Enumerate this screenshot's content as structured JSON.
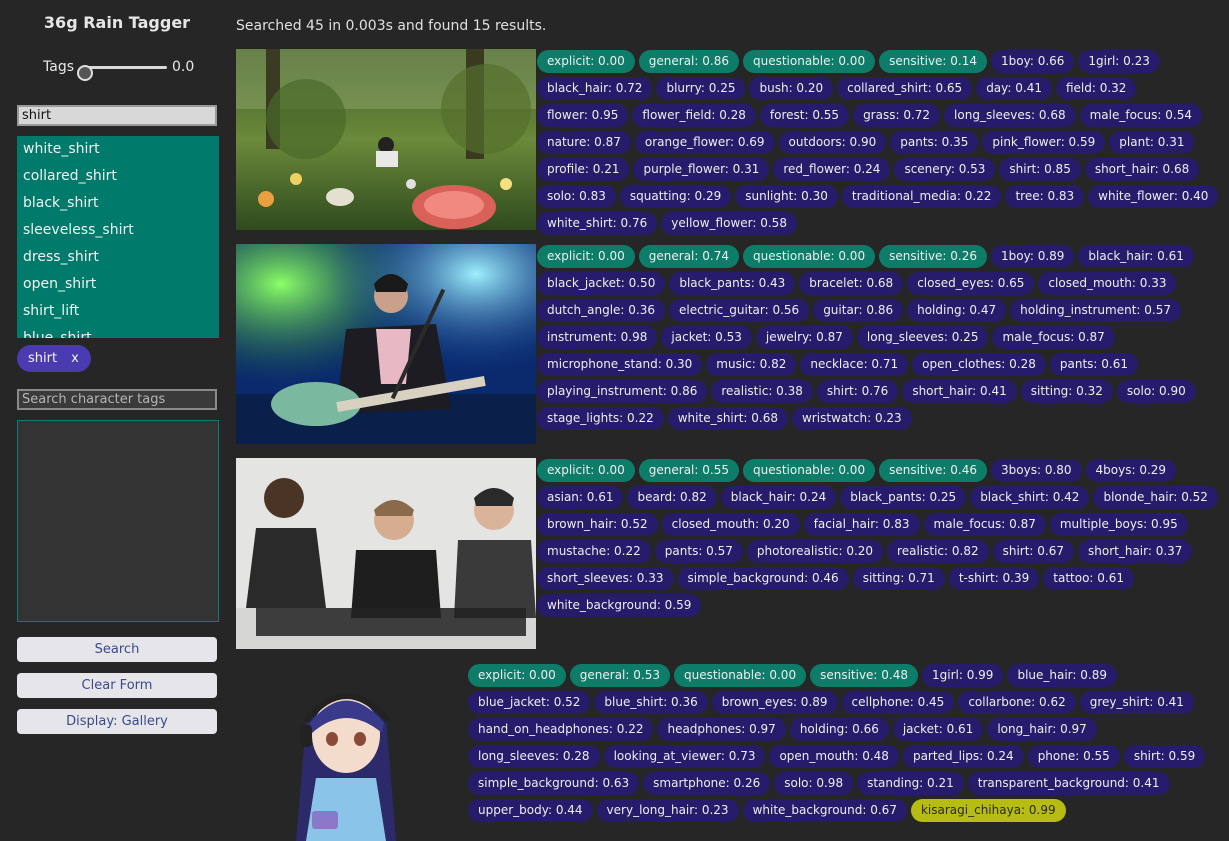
{
  "app": {
    "title": "36g Rain Tagger"
  },
  "controls": {
    "tags_label": "Tags",
    "tags_value": "0.0"
  },
  "tag_search": {
    "value": "shirt"
  },
  "suggestions": [
    "white_shirt",
    "collared_shirt",
    "black_shirt",
    "sleeveless_shirt",
    "dress_shirt",
    "open_shirt",
    "shirt_lift",
    "blue_shirt"
  ],
  "selected_chip": {
    "label": "shirt",
    "remove": "x"
  },
  "character_search": {
    "placeholder": "Search character tags"
  },
  "buttons": {
    "search": "Search",
    "clear": "Clear Form",
    "display": "Display: Gallery"
  },
  "status": "Searched 45 in 0.003s and found 15 results.",
  "colors": {
    "rating_tag": "#0d7d6a",
    "general_tag": "#261c6b",
    "character_tag": "#b6bc12",
    "suggestion_bg": "#007a6b",
    "chip_bg": "#4b3bb0"
  },
  "results": [
    {
      "rating": [
        "explicit: 0.00",
        "general: 0.86",
        "questionable: 0.00",
        "sensitive: 0.14"
      ],
      "general": [
        "1boy: 0.66",
        "1girl: 0.23",
        "black_hair: 0.72",
        "blurry: 0.25",
        "bush: 0.20",
        "collared_shirt: 0.65",
        "day: 0.41",
        "field: 0.32",
        "flower: 0.95",
        "flower_field: 0.28",
        "forest: 0.55",
        "grass: 0.72",
        "long_sleeves: 0.68",
        "male_focus: 0.54",
        "nature: 0.87",
        "orange_flower: 0.69",
        "outdoors: 0.90",
        "pants: 0.35",
        "pink_flower: 0.59",
        "plant: 0.31",
        "profile: 0.21",
        "purple_flower: 0.31",
        "red_flower: 0.24",
        "scenery: 0.53",
        "shirt: 0.85",
        "short_hair: 0.68",
        "solo: 0.83",
        "squatting: 0.29",
        "sunlight: 0.30",
        "traditional_media: 0.22",
        "tree: 0.83",
        "white_flower: 0.40",
        "white_shirt: 0.76",
        "yellow_flower: 0.58"
      ],
      "character": []
    },
    {
      "rating": [
        "explicit: 0.00",
        "general: 0.74",
        "questionable: 0.00",
        "sensitive: 0.26"
      ],
      "general": [
        "1boy: 0.89",
        "black_hair: 0.61",
        "black_jacket: 0.50",
        "black_pants: 0.43",
        "bracelet: 0.68",
        "closed_eyes: 0.65",
        "closed_mouth: 0.33",
        "dutch_angle: 0.36",
        "electric_guitar: 0.56",
        "guitar: 0.86",
        "holding: 0.47",
        "holding_instrument: 0.57",
        "instrument: 0.98",
        "jacket: 0.53",
        "jewelry: 0.87",
        "long_sleeves: 0.25",
        "male_focus: 0.87",
        "microphone_stand: 0.30",
        "music: 0.82",
        "necklace: 0.71",
        "open_clothes: 0.28",
        "pants: 0.61",
        "playing_instrument: 0.86",
        "realistic: 0.38",
        "shirt: 0.76",
        "short_hair: 0.41",
        "sitting: 0.32",
        "solo: 0.90",
        "stage_lights: 0.22",
        "white_shirt: 0.68",
        "wristwatch: 0.23"
      ],
      "character": []
    },
    {
      "rating": [
        "explicit: 0.00",
        "general: 0.55",
        "questionable: 0.00",
        "sensitive: 0.46"
      ],
      "general": [
        "3boys: 0.80",
        "4boys: 0.29",
        "asian: 0.61",
        "beard: 0.82",
        "black_hair: 0.24",
        "black_pants: 0.25",
        "black_shirt: 0.42",
        "blonde_hair: 0.52",
        "brown_hair: 0.52",
        "closed_mouth: 0.20",
        "facial_hair: 0.83",
        "male_focus: 0.87",
        "multiple_boys: 0.95",
        "mustache: 0.22",
        "pants: 0.57",
        "photorealistic: 0.20",
        "realistic: 0.82",
        "shirt: 0.67",
        "short_hair: 0.37",
        "short_sleeves: 0.33",
        "simple_background: 0.46",
        "sitting: 0.71",
        "t-shirt: 0.39",
        "tattoo: 0.61",
        "white_background: 0.59"
      ],
      "character": []
    },
    {
      "rating": [
        "explicit: 0.00",
        "general: 0.53",
        "questionable: 0.00",
        "sensitive: 0.48"
      ],
      "general": [
        "1girl: 0.99",
        "blue_hair: 0.89",
        "blue_jacket: 0.52",
        "blue_shirt: 0.36",
        "brown_eyes: 0.89",
        "cellphone: 0.45",
        "collarbone: 0.62",
        "grey_shirt: 0.41",
        "hand_on_headphones: 0.22",
        "headphones: 0.97",
        "holding: 0.66",
        "jacket: 0.61",
        "long_hair: 0.97",
        "long_sleeves: 0.28",
        "looking_at_viewer: 0.73",
        "open_mouth: 0.48",
        "parted_lips: 0.24",
        "phone: 0.55",
        "shirt: 0.59",
        "simple_background: 0.63",
        "smartphone: 0.26",
        "solo: 0.98",
        "standing: 0.21",
        "transparent_background: 0.41",
        "upper_body: 0.44",
        "very_long_hair: 0.23",
        "white_background: 0.67"
      ],
      "character": [
        "kisaragi_chihaya: 0.99"
      ]
    }
  ]
}
